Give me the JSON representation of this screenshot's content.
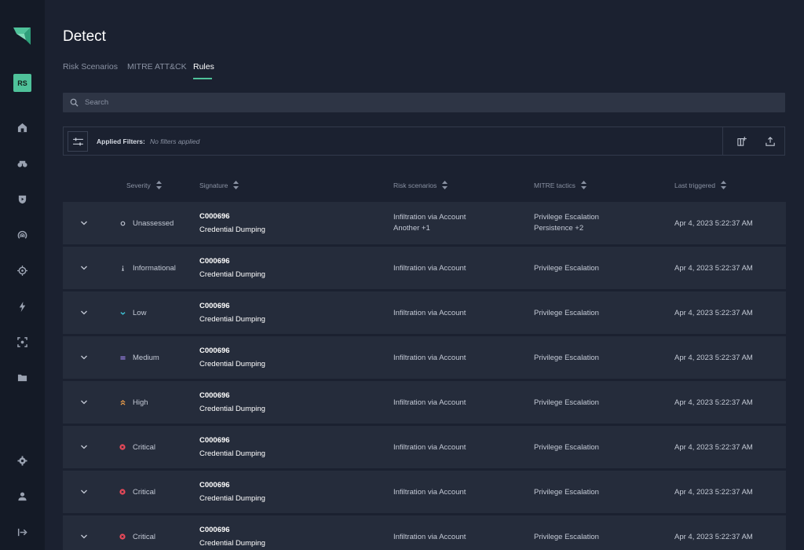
{
  "sidebar": {
    "avatar_initials": "RS",
    "icons": [
      "home-icon",
      "binoculars-icon",
      "shield-icon",
      "broadcast-icon",
      "target-icon",
      "lightning-icon",
      "scan-icon",
      "folder-icon",
      "settings-icon",
      "user-icon",
      "logout-icon"
    ]
  },
  "page": {
    "title": "Detect"
  },
  "tabs": [
    {
      "label": "Risk Scenarios"
    },
    {
      "label": "MITRE ATT&CK"
    },
    {
      "label": "Rules"
    }
  ],
  "search": {
    "placeholder": "Search"
  },
  "filters": {
    "label": "Applied Filters:",
    "value": "No filters applied"
  },
  "table": {
    "headers": {
      "severity": "Severity",
      "signature": "Signature",
      "risk": "Risk scenarios",
      "mitre": "MITRE tactics",
      "last": "Last triggered"
    },
    "rows": [
      {
        "severity": "Unassessed",
        "sig_id": "C000696",
        "sig_name": "Credential Dumping",
        "risk": "Infiltration via Account",
        "risk_extra": "Another +1",
        "mitre": "Privilege Escalation",
        "mitre_extra": "Persistence +2",
        "last": "Apr 4, 2023 5:22:37 AM"
      },
      {
        "severity": "Informational",
        "sig_id": "C000696",
        "sig_name": "Credential Dumping",
        "risk": "Infiltration via Account",
        "mitre": "Privilege Escalation",
        "last": "Apr 4, 2023 5:22:37 AM"
      },
      {
        "severity": "Low",
        "sig_id": "C000696",
        "sig_name": "Credential Dumping",
        "risk": "Infiltration via Account",
        "mitre": "Privilege Escalation",
        "last": "Apr 4, 2023 5:22:37 AM"
      },
      {
        "severity": "Medium",
        "sig_id": "C000696",
        "sig_name": "Credential Dumping",
        "risk": "Infiltration via Account",
        "mitre": "Privilege Escalation",
        "last": "Apr 4, 2023 5:22:37 AM"
      },
      {
        "severity": "High",
        "sig_id": "C000696",
        "sig_name": "Credential Dumping",
        "risk": "Infiltration via Account",
        "mitre": "Privilege Escalation",
        "last": "Apr 4, 2023 5:22:37 AM"
      },
      {
        "severity": "Critical",
        "sig_id": "C000696",
        "sig_name": "Credential Dumping",
        "risk": "Infiltration via Account",
        "mitre": "Privilege Escalation",
        "last": "Apr 4, 2023 5:22:37 AM"
      },
      {
        "severity": "Critical",
        "sig_id": "C000696",
        "sig_name": "Credential Dumping",
        "risk": "Infiltration via Account",
        "mitre": "Privilege Escalation",
        "last": "Apr 4, 2023 5:22:37 AM"
      },
      {
        "severity": "Critical",
        "sig_id": "C000696",
        "sig_name": "Credential Dumping",
        "risk": "Infiltration via Account",
        "mitre": "Privilege Escalation",
        "last": "Apr 4, 2023 5:22:37 AM"
      }
    ]
  },
  "colors": {
    "accent": "#4fc29a",
    "unassessed": "#c4cad6",
    "informational": "#c4cad6",
    "low": "#3fc6d9",
    "medium": "#a78bfa",
    "high": "#f0a04b",
    "critical": "#ef4a5a"
  }
}
